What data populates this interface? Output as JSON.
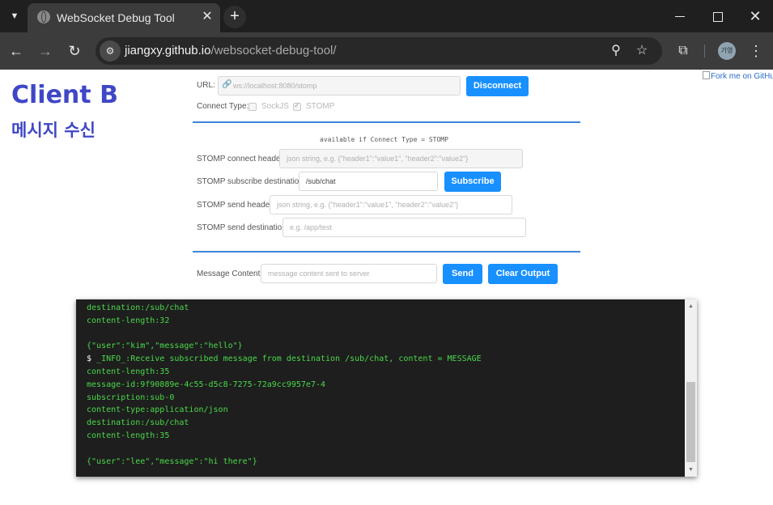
{
  "browser": {
    "tab_title": "WebSocket Debug Tool",
    "tab_menu_icon": "chevron-down-icon",
    "new_tab_label": "+",
    "close_tab_label": "✕",
    "url_domain": "jiangxy.github.io",
    "url_path": "/websocket-debug-tool/",
    "profile_label": "기영",
    "window_controls": [
      "minimize",
      "maximize",
      "close"
    ]
  },
  "page": {
    "client_title": "Client B",
    "client_subtitle": "메시지 수신",
    "fork_link": "Fork me on GitHub"
  },
  "form": {
    "url_label": "URL:",
    "url_value": "ws://localhost:8080/stomp",
    "disconnect_label": "Disconnect",
    "connect_type_label": "Connect Type:",
    "connect_types": [
      {
        "label": "SockJS",
        "checked": false
      },
      {
        "label": "STOMP",
        "checked": true
      }
    ],
    "stomp_note": "available if Connect Type = STOMP",
    "stomp_connect_header_label": "STOMP connect header:",
    "stomp_connect_header_placeholder": "json string, e.g. {\"header1\":\"value1\", \"header2\":\"value2\"}",
    "stomp_subscribe_destination_label": "STOMP subscribe destination:",
    "stomp_subscribe_destination_value": "/sub/chat",
    "subscribe_label": "Subscribe",
    "stomp_send_header_label": "STOMP send header:",
    "stomp_send_header_placeholder": "json string, e.g. {\"header1\":\"value1\", \"header2\":\"value2\"}",
    "stomp_send_destination_label": "STOMP send destination:",
    "stomp_send_destination_placeholder": "e.g. /app/test",
    "message_content_label": "Message Content:",
    "message_content_placeholder": "message content sent to server",
    "send_label": "Send",
    "clear_output_label": "Clear Output"
  },
  "console": {
    "lines": [
      {
        "text": "destination:/sub/chat",
        "prompt": ""
      },
      {
        "text": "content-length:32",
        "prompt": ""
      },
      {
        "text": "",
        "prompt": ""
      },
      {
        "text": "{\"user\":\"kim\",\"message\":\"hello\"}",
        "prompt": ""
      },
      {
        "text": " _INFO_:Receive subscribed message from destination /sub/chat, content = MESSAGE",
        "prompt": "$"
      },
      {
        "text": "content-length:35",
        "prompt": ""
      },
      {
        "text": "message-id:9f90889e-4c55-d5c8-7275-72a9cc9957e7-4",
        "prompt": ""
      },
      {
        "text": "subscription:sub-0",
        "prompt": ""
      },
      {
        "text": "content-type:application/json",
        "prompt": ""
      },
      {
        "text": "destination:/sub/chat",
        "prompt": ""
      },
      {
        "text": "content-length:35",
        "prompt": ""
      },
      {
        "text": "",
        "prompt": ""
      },
      {
        "text": "{\"user\":\"lee\",\"message\":\"hi there\"}",
        "prompt": ""
      }
    ]
  },
  "colors": {
    "accent": "#1890ff",
    "title": "#3f47c6",
    "console_text": "#4ad84a",
    "console_bg": "#1e1e1e"
  }
}
